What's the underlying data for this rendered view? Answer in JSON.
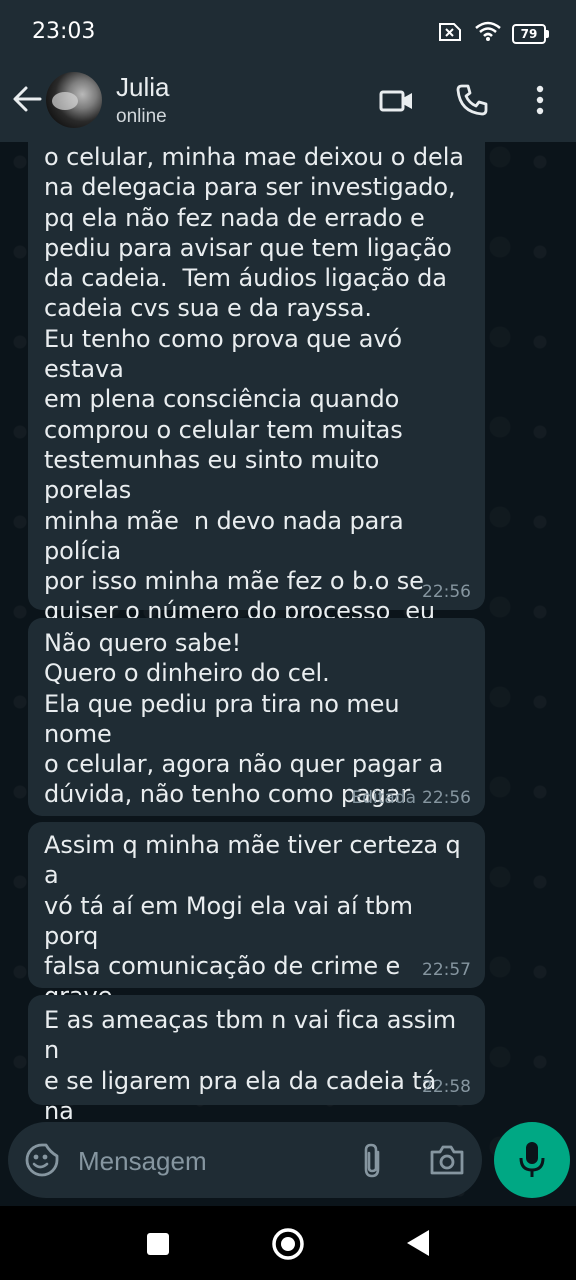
{
  "status_bar": {
    "time": "23:03",
    "battery": "79"
  },
  "header": {
    "contact_name": "Julia",
    "contact_status": "online",
    "icons": [
      "back-arrow-icon",
      "video-call-icon",
      "phone-icon",
      "more-vert-icon"
    ]
  },
  "messages": [
    {
      "text": "o celular, minha mae deixou o dela\nna delegacia para ser investigado,\npq ela não fez nada de errado e\npediu para avisar que tem ligação\nda cadeia.  Tem áudios ligação da\ncadeia cvs sua e da rayssa.\nEu tenho como prova que avó estava\nem plena consciência quando\ncomprou o celular tem muitas\ntestemunhas eu sinto muito porelas\nminha mãe  n devo nada para polícia\npor isso minha mãe fez o b.o se\nquiser o número do processo  eu dou\nEstou te mandando mgs pq sua filha\nquerida me bloqueou",
      "edited": "",
      "time": "22:56"
    },
    {
      "text": "Não quero sabe!\nQuero o dinheiro do cel.\nEla que pediu pra tira no meu nome\no celular, agora não quer pagar a\ndúvida, não tenho como pagar",
      "edited": "Editada",
      "time": "22:56"
    },
    {
      "text": "Assim q minha mãe tiver certeza q a\nvó tá aí em Mogi ela vai aí tbm porq\nfalsa comunicação de crime e grave\ne todos vão responder o endereço da\nRayssa ela já tem",
      "edited": "",
      "time": "22:57"
    },
    {
      "text": "E as ameaças tbm n vai fica assim n\ne se ligarem pra ela da cadeia tá na\npolicia vcs q sabem",
      "edited": "",
      "time": "22:58"
    }
  ],
  "composer": {
    "placeholder": "Mensagem",
    "icons": [
      "emoji-icon",
      "attach-icon",
      "camera-icon",
      "mic-icon"
    ]
  },
  "colors": {
    "background": "#0b141a",
    "bubble": "#1f2c34",
    "accent": "#00a884",
    "meta_text": "#8696a0"
  }
}
